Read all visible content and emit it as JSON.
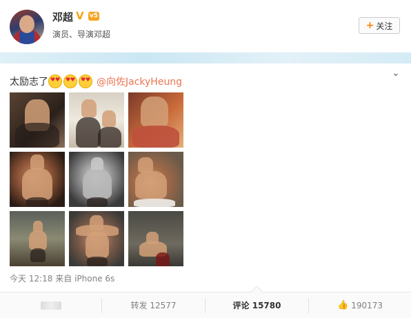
{
  "user": {
    "name": "邓超",
    "verified_mark": "V",
    "vip_mark": "v5",
    "description": "演员、导演邓超",
    "follow_label": "关注"
  },
  "post": {
    "text": "太励志了",
    "emoji_count": 3,
    "mention": "@向佐JackyHeung",
    "time": "今天 12:18",
    "source_prefix": "来自",
    "source": "iPhone 6s",
    "photos": [
      "photo-1",
      "photo-2",
      "photo-3",
      "photo-4",
      "photo-5",
      "photo-6",
      "photo-7",
      "photo-8",
      "photo-9"
    ]
  },
  "actions": {
    "repost_label": "转发",
    "repost_count": "12577",
    "comment_label": "评论",
    "comment_count": "15780",
    "like_count": "190173"
  },
  "icons": {
    "follow": "plus-icon",
    "like": "thumbs-up-icon",
    "expand": "chevron-down-icon"
  },
  "colors": {
    "accent_orange": "#ff8200",
    "mention": "#eb7350",
    "verified": "#f3a414"
  }
}
